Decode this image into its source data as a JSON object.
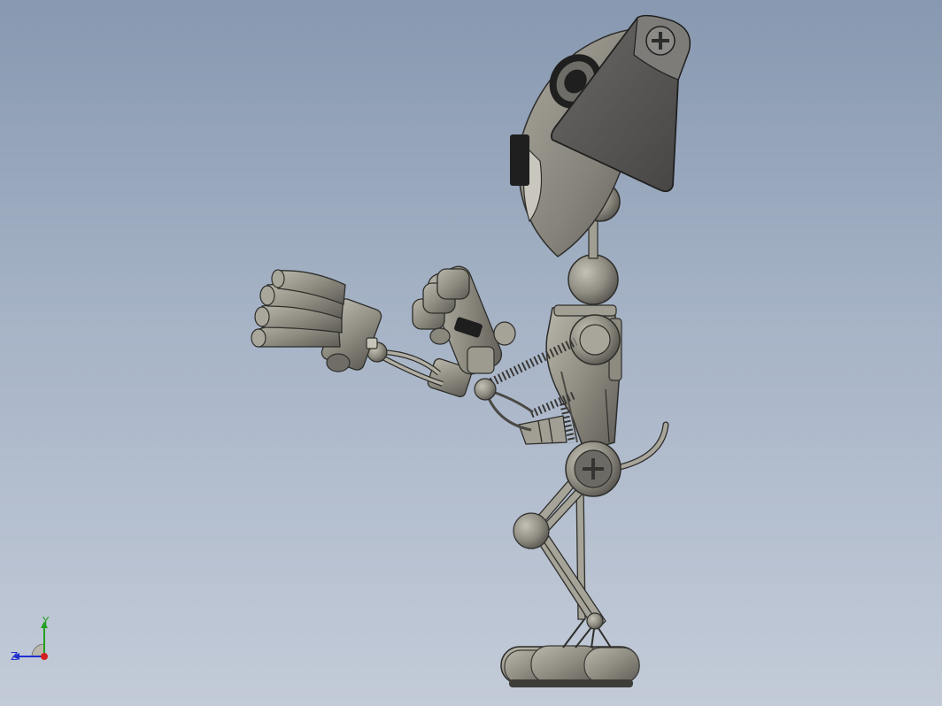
{
  "viewport": {
    "background_top": "#8798b0",
    "background_bottom": "#c3cbd8"
  },
  "model": {
    "icon": "robot-dog-3d-model",
    "body_color": "#8e8b80",
    "shade_color": "#5d5c57",
    "dark_color": "#1f1f1f"
  },
  "triad": {
    "x_label": "",
    "y_label": "Y",
    "z_label": "Z",
    "x_color": "#d42020",
    "y_color": "#22a022",
    "z_color": "#2030d0"
  }
}
